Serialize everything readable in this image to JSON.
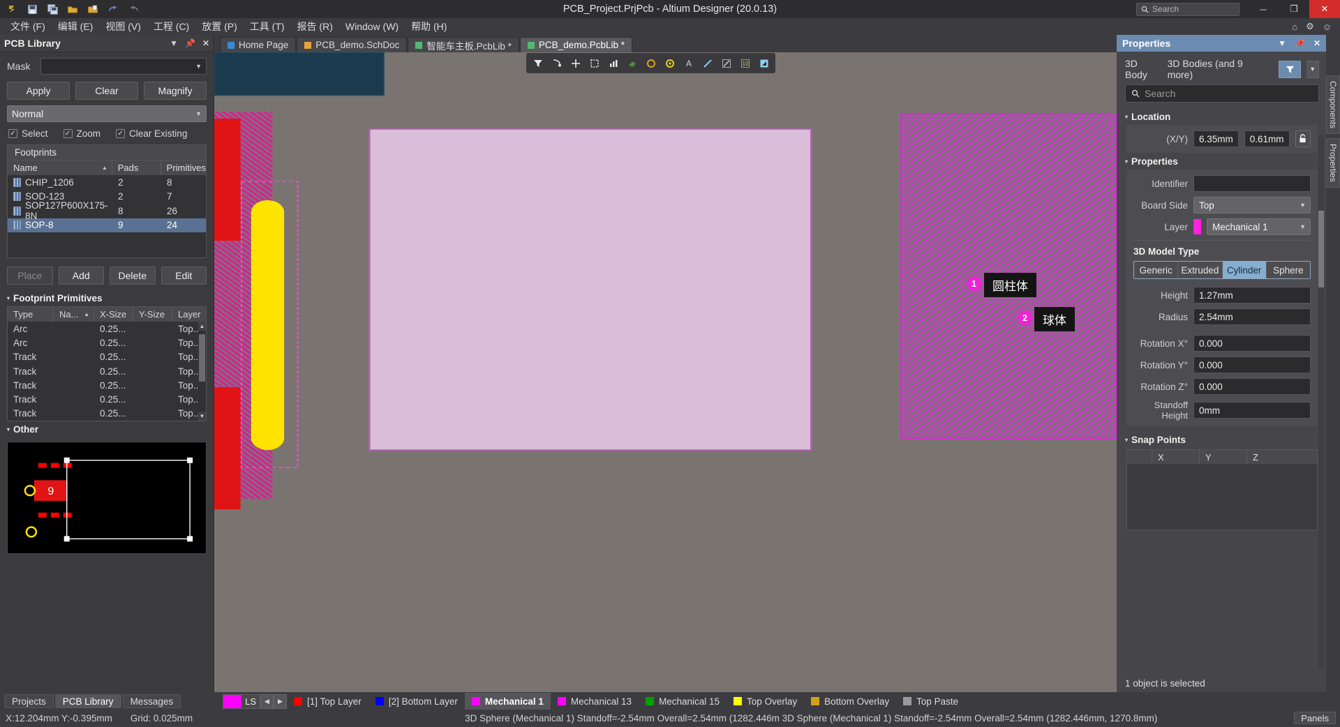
{
  "titlebar": {
    "title": "PCB_Project.PrjPcb - Altium Designer (20.0.13)",
    "search_placeholder": "Search",
    "icons": [
      "altium-logo-icon",
      "save-icon",
      "save-all-icon",
      "open-folder-icon",
      "open-project-icon",
      "undo-icon",
      "redo-icon"
    ],
    "minimize": "─",
    "maximize": "❐",
    "close": "✕"
  },
  "menubar": {
    "items": [
      {
        "label": "文件 (F)"
      },
      {
        "label": "编辑 (E)"
      },
      {
        "label": "视图 (V)"
      },
      {
        "label": "工程 (C)"
      },
      {
        "label": "放置 (P)"
      },
      {
        "label": "工具 (T)"
      },
      {
        "label": "报告 (R)"
      },
      {
        "label": "Window (W)"
      },
      {
        "label": "帮助 (H)"
      }
    ],
    "right_icons": [
      "home-icon",
      "gear-icon",
      "user-icon"
    ]
  },
  "left_panel": {
    "title": "PCB Library",
    "header_controls": [
      "chevron-down-icon",
      "pin-icon",
      "close-icon"
    ],
    "mask_label": "Mask",
    "mask_value": "",
    "buttons": {
      "apply": "Apply",
      "clear": "Clear",
      "magnify": "Magnify"
    },
    "mode_value": "Normal",
    "checks": [
      {
        "label": "Select",
        "checked": true
      },
      {
        "label": "Zoom",
        "checked": true
      },
      {
        "label": "Clear Existing",
        "checked": true
      }
    ],
    "footprints": {
      "section_label": "Footprints",
      "columns": [
        "Name",
        "Pads",
        "Primitives"
      ],
      "sort_column": "Name",
      "rows": [
        {
          "name": "CHIP_1206",
          "pads": "2",
          "primitives": "8",
          "selected": false
        },
        {
          "name": "SOD-123",
          "pads": "2",
          "primitives": "7",
          "selected": false
        },
        {
          "name": "SOP127P600X175-8N",
          "pads": "8",
          "primitives": "26",
          "selected": false
        },
        {
          "name": "SOP-8",
          "pads": "9",
          "primitives": "24",
          "selected": true
        }
      ]
    },
    "action_buttons": [
      {
        "label": "Place",
        "disabled": true
      },
      {
        "label": "Add",
        "disabled": false
      },
      {
        "label": "Delete",
        "disabled": false
      },
      {
        "label": "Edit",
        "disabled": false
      }
    ],
    "primitives": {
      "section_label": "Footprint Primitives",
      "columns": [
        "Type",
        "Na...",
        "X-Size",
        "Y-Size",
        "Layer"
      ],
      "sort_column": "Na...",
      "rows": [
        {
          "type": "Arc",
          "name": "",
          "xsize": "0.25...",
          "ysize": "",
          "layer": "Top..."
        },
        {
          "type": "Arc",
          "name": "",
          "xsize": "0.25...",
          "ysize": "",
          "layer": "Top..."
        },
        {
          "type": "Track",
          "name": "",
          "xsize": "0.25...",
          "ysize": "",
          "layer": "Top..."
        },
        {
          "type": "Track",
          "name": "",
          "xsize": "0.25...",
          "ysize": "",
          "layer": "Top..."
        },
        {
          "type": "Track",
          "name": "",
          "xsize": "0.25...",
          "ysize": "",
          "layer": "Top..."
        },
        {
          "type": "Track",
          "name": "",
          "xsize": "0.25...",
          "ysize": "",
          "layer": "Top..."
        },
        {
          "type": "Track",
          "name": "",
          "xsize": "0.25...",
          "ysize": "",
          "layer": "Top..."
        }
      ]
    },
    "other": {
      "section_label": "Other",
      "pad_number": "9"
    }
  },
  "doc_tabs": [
    {
      "label": "Home Page",
      "icon": "home-icon",
      "active": false,
      "color": "#3a8ad4"
    },
    {
      "label": "PCB_demo.SchDoc",
      "icon": "sch-doc-icon",
      "active": false,
      "color": "#e6a23c"
    },
    {
      "label": "智能车主板.PcbLib *",
      "icon": "pcblib-icon",
      "active": false,
      "color": "#56b870"
    },
    {
      "label": "PCB_demo.PcbLib *",
      "icon": "pcblib-icon",
      "active": true,
      "color": "#56b870"
    }
  ],
  "canvas_toolbar": {
    "icons": [
      "filter-icon",
      "select-touch-icon",
      "crosshair-icon",
      "rect-select-icon",
      "bar-chart-icon",
      "eraser-icon",
      "circle-orange-icon",
      "circle-yellow-icon",
      "letter-a-icon",
      "line-icon",
      "measure-icon",
      "chart-icon",
      "fill-icon"
    ]
  },
  "properties": {
    "title": "Properties",
    "header_controls": [
      "chevron-down-icon",
      "pin-icon",
      "close-icon"
    ],
    "object_type": "3D Body",
    "object_count": "3D Bodies (and 9 more)",
    "search_placeholder": "Search",
    "sections": {
      "location": {
        "label": "Location",
        "xy_label": "(X/Y)",
        "x_value": "6.35mm",
        "y_value": "0.61mm",
        "lock_icon": "unlock-icon"
      },
      "properties": {
        "label": "Properties",
        "identifier_label": "Identifier",
        "identifier_value": "",
        "board_side_label": "Board Side",
        "board_side_value": "Top",
        "layer_label": "Layer",
        "layer_value": "Mechanical 1",
        "layer_color": "#ff22e0",
        "model_type_label": "3D Model Type",
        "model_types": [
          {
            "label": "Generic",
            "active": false
          },
          {
            "label": "Extruded",
            "active": false
          },
          {
            "label": "Cylinder",
            "active": true
          },
          {
            "label": "Sphere",
            "active": false
          }
        ],
        "fields": [
          {
            "label": "Height",
            "value": "1.27mm"
          },
          {
            "label": "Radius",
            "value": "2.54mm"
          },
          {
            "label": "Rotation X°",
            "value": "0.000"
          },
          {
            "label": "Rotation Y°",
            "value": "0.000"
          },
          {
            "label": "Rotation Z°",
            "value": "0.000"
          },
          {
            "label": "Standoff Height",
            "value": "0mm"
          }
        ]
      },
      "snap_points": {
        "label": "Snap Points",
        "columns": [
          "",
          "X",
          "Y",
          "Z"
        ],
        "rows": []
      }
    },
    "status": "1 object is selected"
  },
  "annotations": [
    {
      "number": "1",
      "text": "圆柱体"
    },
    {
      "number": "2",
      "text": "球体"
    }
  ],
  "edge_tabs": [
    {
      "label": "Components"
    },
    {
      "label": "Properties"
    }
  ],
  "bottom": {
    "panel_tabs": [
      {
        "label": "Projects",
        "active": false
      },
      {
        "label": "PCB Library",
        "active": true
      },
      {
        "label": "Messages",
        "active": false
      }
    ],
    "layer_selector": {
      "swatch_color": "#ff00ff",
      "label": "LS"
    },
    "layer_tabs": [
      {
        "label": "[1] Top Layer",
        "color": "#ff0000",
        "active": false
      },
      {
        "label": "[2] Bottom Layer",
        "color": "#0000ff",
        "active": false
      },
      {
        "label": "Mechanical 1",
        "color": "#ff00ff",
        "active": true
      },
      {
        "label": "Mechanical 13",
        "color": "#ff00ff",
        "active": false
      },
      {
        "label": "Mechanical 15",
        "color": "#00a000",
        "active": false
      },
      {
        "label": "Top Overlay",
        "color": "#ffff00",
        "active": false
      },
      {
        "label": "Bottom Overlay",
        "color": "#d4a017",
        "active": false
      },
      {
        "label": "Top Paste",
        "color": "#9a9a9a",
        "active": false
      }
    ],
    "status": {
      "coords": "X:12.204mm Y:-0.395mm",
      "grid": "Grid: 0.025mm",
      "info": "3D Sphere  (Mechanical 1)  Standoff=-2.54mm  Overall=2.54mm  (1282.446m 3D Sphere  (Mechanical 1)  Standoff=-2.54mm  Overall=2.54mm  (1282.446mm, 1270.8mm)",
      "panels_button": "Panels"
    }
  }
}
